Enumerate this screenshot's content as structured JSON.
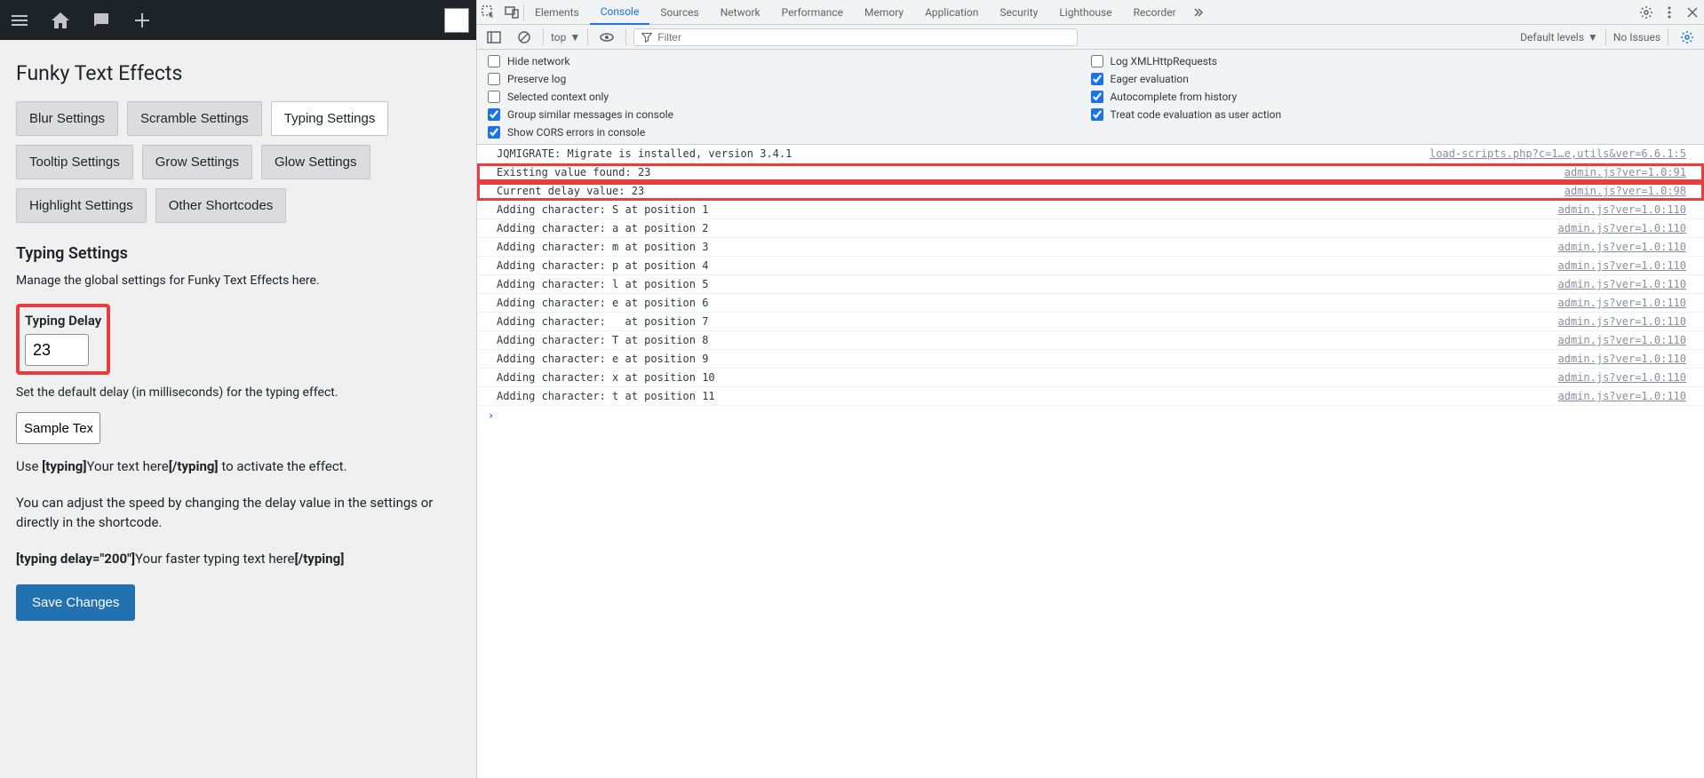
{
  "wp": {
    "page_title": "Funky Text Effects",
    "tabs_row1": [
      {
        "label": "Blur Settings",
        "active": false
      },
      {
        "label": "Scramble Settings",
        "active": false
      },
      {
        "label": "Typing Settings",
        "active": true
      }
    ],
    "tabs_row2": [
      {
        "label": "Tooltip Settings",
        "active": false
      },
      {
        "label": "Grow Settings",
        "active": false
      },
      {
        "label": "Glow Settings",
        "active": false
      }
    ],
    "tabs_row3": [
      {
        "label": "Highlight Settings",
        "active": false
      },
      {
        "label": "Other Shortcodes",
        "active": false
      }
    ],
    "section_title": "Typing Settings",
    "description": "Manage the global settings for Funky Text Effects here.",
    "typing_delay_label": "Typing Delay",
    "typing_delay_value": "23",
    "delay_help": "Set the default delay (in milliseconds) for the typing effect.",
    "sample_text_value": "Sample Text",
    "usage1_pre": "Use ",
    "usage1_open": "[typing]",
    "usage1_mid": "Your text here",
    "usage1_close": "[/typing]",
    "usage1_post": " to activate the effect.",
    "usage2": "You can adjust the speed by changing the delay value in the settings or directly in the shortcode.",
    "usage3_open": "[typing delay=\"200\"]",
    "usage3_mid": "Your faster typing text here",
    "usage3_close": "[/typing]",
    "save_label": "Save Changes"
  },
  "devtools": {
    "tabs": [
      "Elements",
      "Console",
      "Sources",
      "Network",
      "Performance",
      "Memory",
      "Application",
      "Security",
      "Lighthouse",
      "Recorder"
    ],
    "active_tab": "Console",
    "context": "top",
    "filter_placeholder": "Filter",
    "levels": "Default levels",
    "issues": "No Issues",
    "settings_col1": [
      {
        "label": "Hide network",
        "checked": false
      },
      {
        "label": "Preserve log",
        "checked": false
      },
      {
        "label": "Selected context only",
        "checked": false
      },
      {
        "label": "Group similar messages in console",
        "checked": true
      },
      {
        "label": "Show CORS errors in console",
        "checked": true
      }
    ],
    "settings_col2": [
      {
        "label": "Log XMLHttpRequests",
        "checked": false
      },
      {
        "label": "Eager evaluation",
        "checked": true
      },
      {
        "label": "Autocomplete from history",
        "checked": true
      },
      {
        "label": "Treat code evaluation as user action",
        "checked": true
      }
    ],
    "logs": [
      {
        "msg": "JQMIGRATE: Migrate is installed, version 3.4.1",
        "src": "load-scripts.php?c=1…e,utils&ver=6.6.1:5",
        "hl": false
      },
      {
        "msg": "Existing value found: 23",
        "src": "admin.js?ver=1.0:91",
        "hl": true
      },
      {
        "msg": "Current delay value: 23",
        "src": "admin.js?ver=1.0:98",
        "hl": true
      },
      {
        "msg": "Adding character: S at position 1",
        "src": "admin.js?ver=1.0:110",
        "hl": false
      },
      {
        "msg": "Adding character: a at position 2",
        "src": "admin.js?ver=1.0:110",
        "hl": false
      },
      {
        "msg": "Adding character: m at position 3",
        "src": "admin.js?ver=1.0:110",
        "hl": false
      },
      {
        "msg": "Adding character: p at position 4",
        "src": "admin.js?ver=1.0:110",
        "hl": false
      },
      {
        "msg": "Adding character: l at position 5",
        "src": "admin.js?ver=1.0:110",
        "hl": false
      },
      {
        "msg": "Adding character: e at position 6",
        "src": "admin.js?ver=1.0:110",
        "hl": false
      },
      {
        "msg": "Adding character:   at position 7",
        "src": "admin.js?ver=1.0:110",
        "hl": false
      },
      {
        "msg": "Adding character: T at position 8",
        "src": "admin.js?ver=1.0:110",
        "hl": false
      },
      {
        "msg": "Adding character: e at position 9",
        "src": "admin.js?ver=1.0:110",
        "hl": false
      },
      {
        "msg": "Adding character: x at position 10",
        "src": "admin.js?ver=1.0:110",
        "hl": false
      },
      {
        "msg": "Adding character: t at position 11",
        "src": "admin.js?ver=1.0:110",
        "hl": false
      }
    ]
  }
}
